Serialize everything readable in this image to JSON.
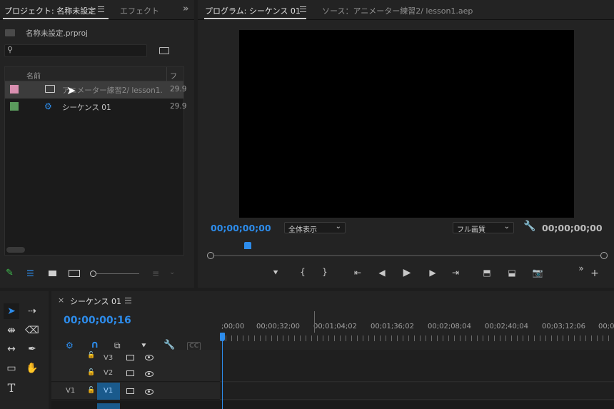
{
  "project_panel": {
    "tab_title": "プロジェクト: 名称未設定",
    "tab_effects": "エフェクト",
    "project_file": "名称未設定.prproj",
    "column_name": "名前",
    "column_framerate": "フレ",
    "items": [
      {
        "name": "アニメーター練習2/ lesson1.",
        "fps": "29.9",
        "color": "#d98fb0"
      },
      {
        "name": "シーケンス 01",
        "fps": "29.9",
        "color": "#5a9a5c"
      }
    ]
  },
  "program_monitor": {
    "tab_program": "プログラム: シーケンス 01",
    "tab_source": "ソース：アニメーター練習2/ lesson1.aep",
    "timecode_in": "00;00;00;00",
    "zoom_value": "全体表示",
    "quality_value": "フル画質",
    "timecode_out": "00;00;00;00"
  },
  "timeline": {
    "tab_title": "シーケンス 01",
    "close_glyph": "×",
    "playhead_timecode": "00;00;00;16",
    "ruler_labels": [
      ";00;00",
      "00;00;32;00",
      "00;01;04;02",
      "00;01;36;02",
      "00;02;08;04",
      "00;02;40;04",
      "00;03;12;06",
      "00;0"
    ],
    "cc_label": "CC",
    "tracks": [
      {
        "source": "",
        "target": "V3"
      },
      {
        "source": "",
        "target": "V2"
      },
      {
        "source": "V1",
        "target": "V1"
      }
    ]
  },
  "colors": {
    "accent_blue": "#2d8ceb",
    "track_target_blue": "#1a5a8c"
  }
}
